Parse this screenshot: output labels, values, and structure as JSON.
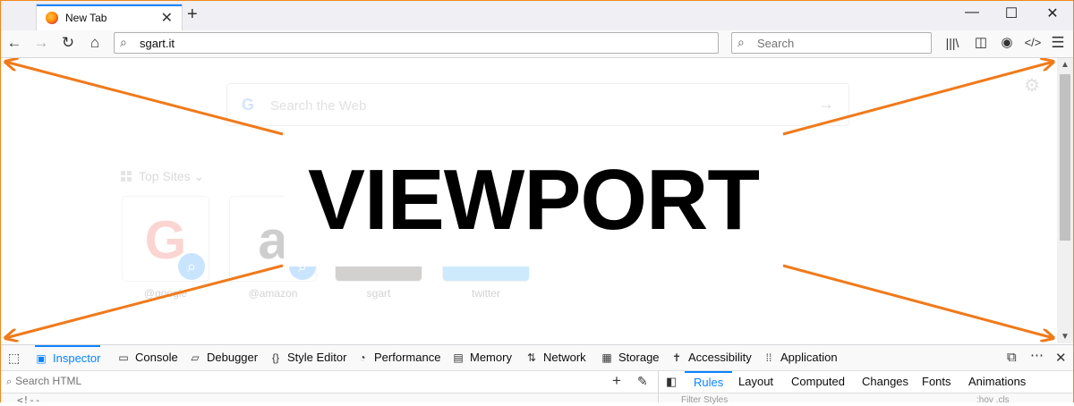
{
  "browser": {
    "tab_title": "New Tab",
    "tab_close": "✕",
    "new_tab": "+",
    "window_controls": {
      "minimize": "—",
      "maximize": "☐",
      "close": "✕"
    },
    "nav": {
      "back": "←",
      "forward": "→",
      "reload": "↻",
      "home": "⌂"
    },
    "url": "sgart.it",
    "search_placeholder": "Search",
    "toolbar_icons": [
      "library-icon",
      "sidebar-icon",
      "account-icon",
      "developer-icon",
      "menu-icon"
    ]
  },
  "viewport": {
    "label": "VIEWPORT",
    "ntp_search_placeholder": "Search the Web",
    "ntp_search_logo": "G",
    "top_sites_title": "Top Sites",
    "top_sites": [
      {
        "label": "@google",
        "letter": "G"
      },
      {
        "label": "@amazon",
        "letter": "a"
      },
      {
        "label": "sgart",
        "letter": "S"
      },
      {
        "label": "twitter",
        "letter": "t"
      }
    ],
    "arrow_color": "#f07a1a"
  },
  "devtools": {
    "tabs": [
      {
        "label": "Inspector",
        "icon": "inspector-icon",
        "selected": true
      },
      {
        "label": "Console",
        "icon": "console-icon"
      },
      {
        "label": "Debugger",
        "icon": "debugger-icon"
      },
      {
        "label": "Style Editor",
        "icon": "style-editor-icon"
      },
      {
        "label": "Performance",
        "icon": "performance-icon"
      },
      {
        "label": "Memory",
        "icon": "memory-icon"
      },
      {
        "label": "Network",
        "icon": "network-icon"
      },
      {
        "label": "Storage",
        "icon": "storage-icon"
      },
      {
        "label": "Accessibility",
        "icon": "accessibility-icon"
      },
      {
        "label": "Application",
        "icon": "application-icon"
      }
    ],
    "search_html_placeholder": "Search HTML",
    "markup_snippet": "<!--",
    "sidebar_tabs": [
      {
        "label": "Rules",
        "selected": true
      },
      {
        "label": "Layout"
      },
      {
        "label": "Computed"
      },
      {
        "label": "Changes"
      },
      {
        "label": "Fonts"
      },
      {
        "label": "Animations"
      }
    ],
    "filter_styles_placeholder": "Filter Styles",
    "filter_flags": ":hov  .cls"
  },
  "colors": {
    "accent": "#0a84ff",
    "frame": "#f0861c",
    "arrow": "#f07a1a"
  }
}
